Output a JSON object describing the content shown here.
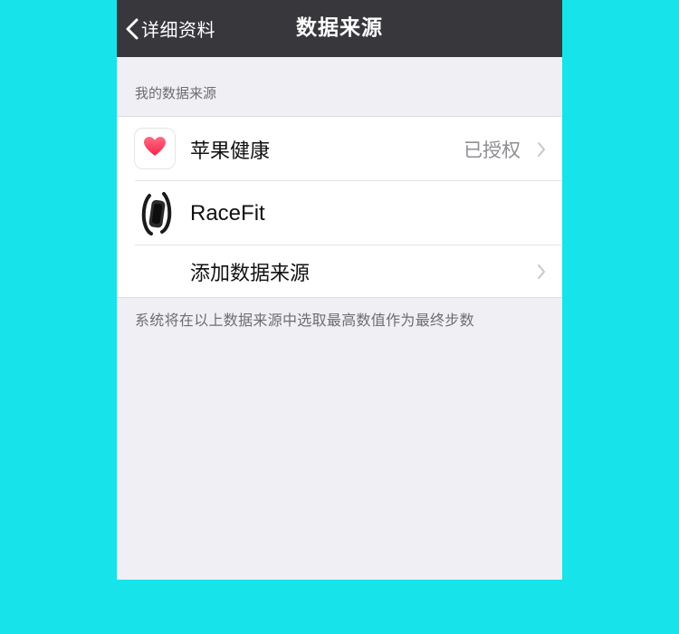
{
  "navbar": {
    "back_label": "详细资料",
    "title": "数据来源",
    "background": "#38373c"
  },
  "section": {
    "header": "我的数据来源"
  },
  "sources": [
    {
      "label": "苹果健康",
      "value": "已授权",
      "icon": "heart-icon"
    },
    {
      "label": "RaceFit",
      "icon": "fitness-band-icon"
    },
    {
      "label": "添加数据来源"
    }
  ],
  "footer": {
    "note": "系统将在以上数据来源中选取最高数值作为最终步数"
  },
  "colors": {
    "page_background": "#17e3ea",
    "screen_background": "#efeff4",
    "heart": "#fb3b5e"
  }
}
